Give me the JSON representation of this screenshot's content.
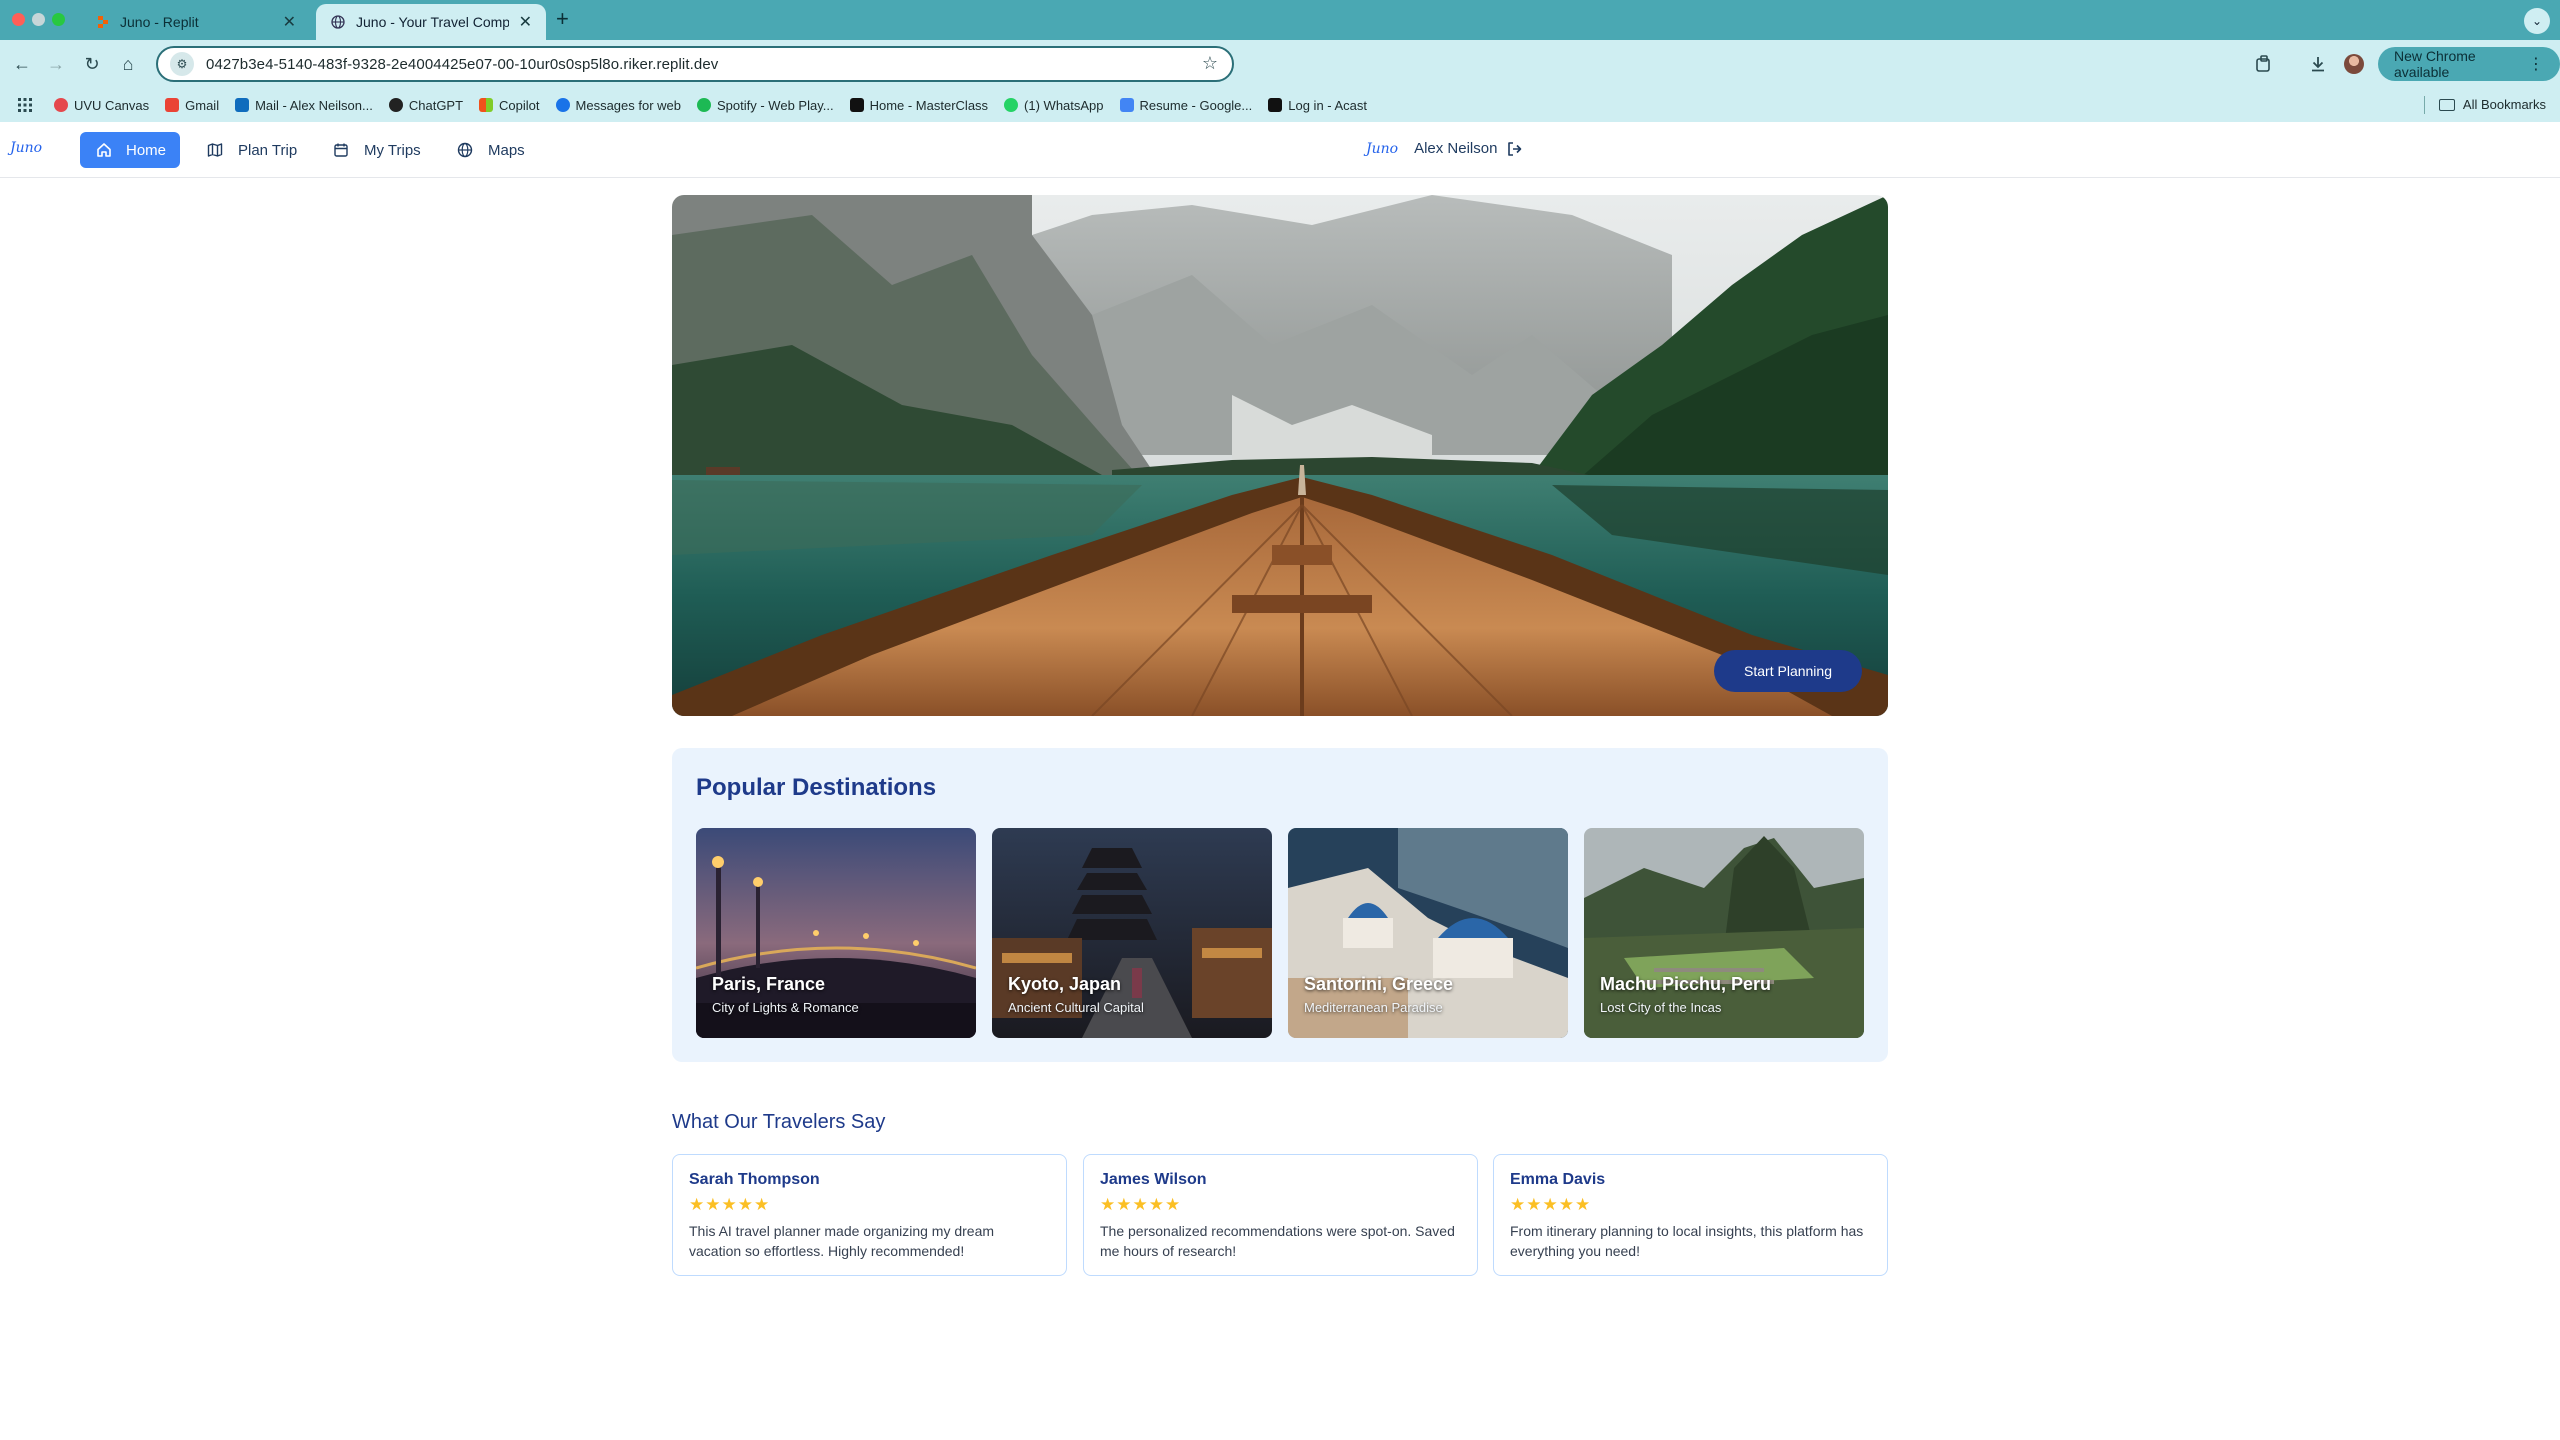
{
  "browser": {
    "tabs": [
      {
        "title": "Juno - Replit",
        "active": false
      },
      {
        "title": "Juno - Your Travel Companio",
        "active": true
      }
    ],
    "new_tab": "+",
    "tab_menu": "⌄",
    "url": "0427b3e4-5140-483f-9328-2e4004425e07-00-10ur0s0sp5l8o.riker.replit.dev",
    "new_chrome": "New Chrome available",
    "bookmarks": [
      {
        "label": "UVU Canvas",
        "color": "#e5484d"
      },
      {
        "label": "Gmail",
        "color": "#ea4335"
      },
      {
        "label": "Mail - Alex Neilson...",
        "color": "#0f6cbd"
      },
      {
        "label": "ChatGPT",
        "color": "#222222"
      },
      {
        "label": "Copilot",
        "color": "#f1511b"
      },
      {
        "label": "Messages for web",
        "color": "#1a73e8"
      },
      {
        "label": "Spotify - Web Play...",
        "color": "#1db954"
      },
      {
        "label": "Home - MasterClass",
        "color": "#111111"
      },
      {
        "label": "(1) WhatsApp",
        "color": "#25d366"
      },
      {
        "label": "Resume - Google...",
        "color": "#4285f4"
      },
      {
        "label": "Log in - Acast",
        "color": "#111111"
      }
    ],
    "all_bookmarks": "All Bookmarks"
  },
  "app": {
    "logo": "Juno",
    "nav": [
      {
        "label": "Home",
        "icon": "home-icon",
        "active": true
      },
      {
        "label": "Plan Trip",
        "icon": "map-icon",
        "active": false
      },
      {
        "label": "My Trips",
        "icon": "calendar-icon",
        "active": false
      },
      {
        "label": "Maps",
        "icon": "globe-icon",
        "active": false
      }
    ],
    "user_name": "Alex Neilson",
    "hero": {
      "cta": "Start Planning"
    },
    "popular": {
      "title": "Popular Destinations",
      "destinations": [
        {
          "name": "Paris, France",
          "subtitle": "City of Lights & Romance"
        },
        {
          "name": "Kyoto, Japan",
          "subtitle": "Ancient Cultural Capital"
        },
        {
          "name": "Santorini, Greece",
          "subtitle": "Mediterranean Paradise"
        },
        {
          "name": "Machu Picchu, Peru",
          "subtitle": "Lost City of the Incas"
        }
      ]
    },
    "testimonials": {
      "title": "What Our Travelers Say",
      "items": [
        {
          "name": "Sarah Thompson",
          "rating": 5,
          "stars": "★★★★★",
          "text": "This AI travel planner made organizing my dream vacation so effortless. Highly recommended!"
        },
        {
          "name": "James Wilson",
          "rating": 5,
          "stars": "★★★★★",
          "text": "The personalized recommendations were spot-on. Saved me hours of research!"
        },
        {
          "name": "Emma Davis",
          "rating": 5,
          "stars": "★★★★★",
          "text": "From itinerary planning to local insights, this platform has everything you need!"
        }
      ]
    }
  },
  "colors": {
    "chrome_frame": "#4aa8b3",
    "chrome_toolbar": "#cfeef2",
    "accent": "#3b82f6",
    "navy": "#1e3a8a",
    "star": "#fbbf24"
  }
}
